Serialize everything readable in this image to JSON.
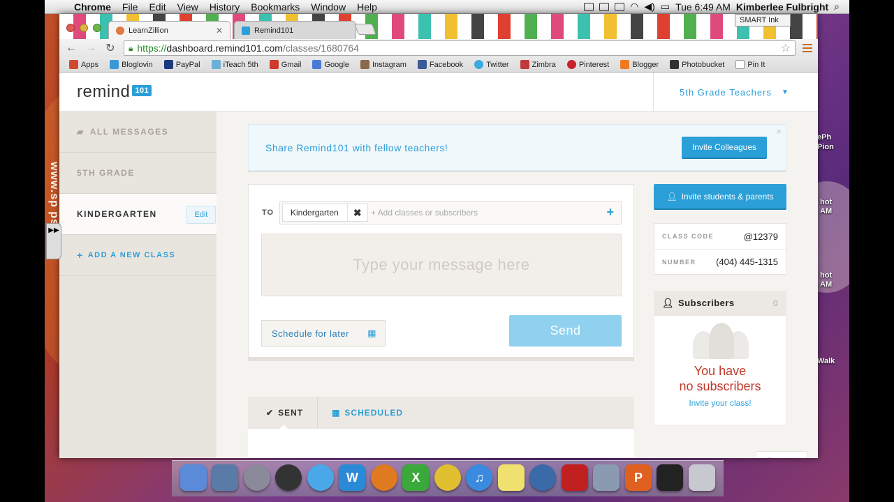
{
  "menubar": {
    "app": "Chrome",
    "items": [
      "File",
      "Edit",
      "View",
      "History",
      "Bookmarks",
      "Window",
      "Help"
    ],
    "clock": "Tue 6:49 AM",
    "user": "Kimberlee Fulbright"
  },
  "overlay": {
    "smart_ink": "SMART Ink",
    "watermark": "www.sp     ps.com"
  },
  "desktop_labels": [
    "ePh",
    "Pion",
    "hot",
    "AM",
    "hot",
    "AM",
    "Walk"
  ],
  "browser": {
    "tabs": [
      {
        "label": "LearnZillion",
        "active": true
      },
      {
        "label": "Remind101",
        "active": false
      }
    ],
    "url": {
      "scheme": "https://",
      "host": "dashboard.remind101.com",
      "path": "/classes/1680764"
    },
    "bookmarks": [
      {
        "label": "Apps",
        "color": "#d04a30"
      },
      {
        "label": "Bloglovin",
        "color": "#3a9ad8"
      },
      {
        "label": "PayPal",
        "color": "#1a3a7a"
      },
      {
        "label": "iTeach 5th",
        "color": "#6ab0d8"
      },
      {
        "label": "Gmail",
        "color": "#d03a2a"
      },
      {
        "label": "Google",
        "color": "#4a7ad8"
      },
      {
        "label": "Instagram",
        "color": "#8a6a4a"
      },
      {
        "label": "Facebook",
        "color": "#3a5a9a"
      },
      {
        "label": "Twitter",
        "color": "#3aaae0"
      },
      {
        "label": "Zimbra",
        "color": "#c03a3a"
      },
      {
        "label": "Pinterest",
        "color": "#c8232c"
      },
      {
        "label": "Blogger",
        "color": "#f07a20"
      },
      {
        "label": "Photobucket",
        "color": "#333333"
      },
      {
        "label": "Pin It",
        "color": "#ffffff"
      }
    ]
  },
  "app": {
    "logo_text": "remind",
    "logo_badge": "101",
    "class_switcher": "5th Grade Teachers",
    "sidebar": {
      "all_messages": "ALL MESSAGES",
      "classes": [
        "5TH GRADE",
        "KINDERGARTEN"
      ],
      "edit": "Edit",
      "add_class": "ADD A NEW CLASS"
    },
    "banner": {
      "text": "Share Remind101 with fellow teachers!",
      "button": "Invite Colleagues",
      "close": "×"
    },
    "composer": {
      "to_label": "TO",
      "chip": "Kindergarten",
      "chip_remove": "✖",
      "add_placeholder": "+ Add classes or subscribers",
      "message_placeholder": "Type your message here",
      "schedule": "Schedule for later",
      "send": "Send"
    },
    "history": {
      "sent": "SENT",
      "scheduled": "SCHEDULED"
    },
    "right": {
      "invite_button": "Invite students & parents",
      "class_code_label": "CLASS CODE",
      "class_code": "@12379",
      "number_label": "NUMBER",
      "number": "(404) 445-1315",
      "subscribers_title": "Subscribers",
      "subscribers_count": "0",
      "no_subs_line1": "You have",
      "no_subs_line2": "no subscribers",
      "invite_class": "Invite your class!"
    },
    "support": "Support"
  },
  "colors": {
    "accent": "#2a9fd8",
    "send_disabled": "#8fd1ee",
    "empty_state": "#c0392b"
  }
}
